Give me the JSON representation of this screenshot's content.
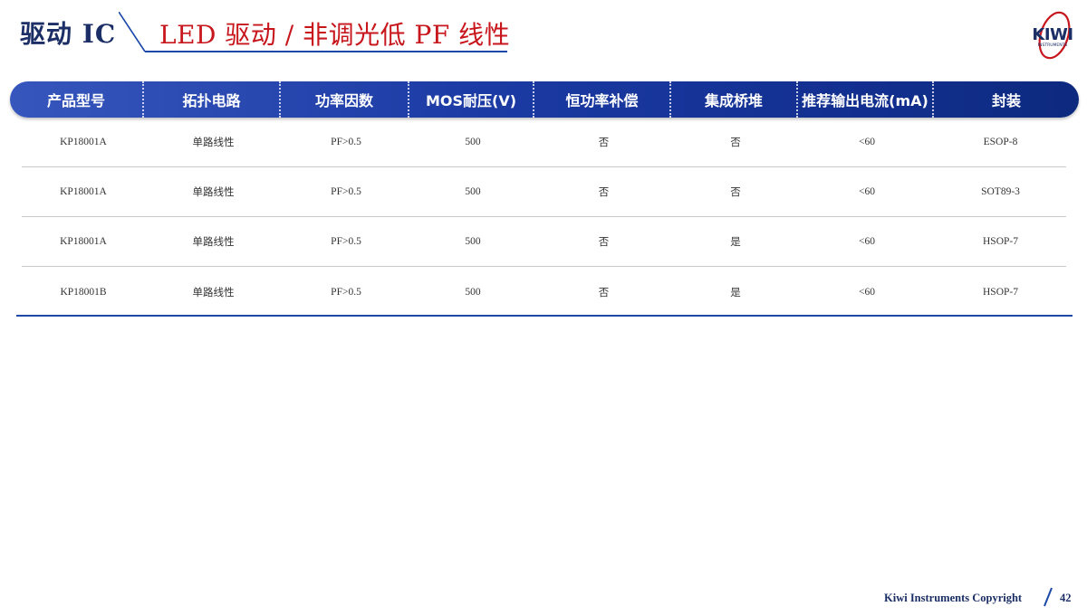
{
  "header": {
    "section_title": "驱动 IC",
    "subtitle": "LED 驱动 / 非调光低 PF 线性",
    "logo_text": "KIWI",
    "logo_subtext": "INSTRUMENTS"
  },
  "table": {
    "columns": [
      "产品型号",
      "拓扑电路",
      "功率因数",
      "MOS耐压(V)",
      "恒功率补偿",
      "集成桥堆",
      "推荐输出电流(mA)",
      "封装"
    ],
    "rows": [
      [
        "KP18001A",
        "单路线性",
        "PF>0.5",
        "500",
        "否",
        "否",
        "<60",
        "ESOP-8"
      ],
      [
        "KP18001A",
        "单路线性",
        "PF>0.5",
        "500",
        "否",
        "否",
        "<60",
        "SOT89-3"
      ],
      [
        "KP18001A",
        "单路线性",
        "PF>0.5",
        "500",
        "否",
        "是",
        "<60",
        "HSOP-7"
      ],
      [
        "KP18001B",
        "单路线性",
        "PF>0.5",
        "500",
        "否",
        "是",
        "<60",
        "HSOP-7"
      ]
    ]
  },
  "footer": {
    "copyright": "Kiwi Instruments Copyright",
    "page_number": "42"
  },
  "colors": {
    "title_navy": "#1b2f66",
    "subtitle_red": "#c8161d",
    "header_blue": "#1b3aa3",
    "rule_blue": "#1a49a8"
  }
}
